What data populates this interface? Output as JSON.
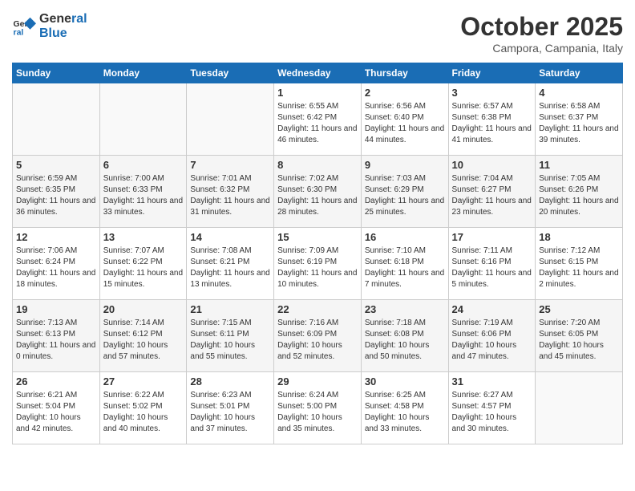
{
  "header": {
    "logo_line1": "General",
    "logo_line2": "Blue",
    "month": "October 2025",
    "location": "Campora, Campania, Italy"
  },
  "days_of_week": [
    "Sunday",
    "Monday",
    "Tuesday",
    "Wednesday",
    "Thursday",
    "Friday",
    "Saturday"
  ],
  "weeks": [
    [
      {
        "day": "",
        "info": ""
      },
      {
        "day": "",
        "info": ""
      },
      {
        "day": "",
        "info": ""
      },
      {
        "day": "1",
        "info": "Sunrise: 6:55 AM\nSunset: 6:42 PM\nDaylight: 11 hours and 46 minutes."
      },
      {
        "day": "2",
        "info": "Sunrise: 6:56 AM\nSunset: 6:40 PM\nDaylight: 11 hours and 44 minutes."
      },
      {
        "day": "3",
        "info": "Sunrise: 6:57 AM\nSunset: 6:38 PM\nDaylight: 11 hours and 41 minutes."
      },
      {
        "day": "4",
        "info": "Sunrise: 6:58 AM\nSunset: 6:37 PM\nDaylight: 11 hours and 39 minutes."
      }
    ],
    [
      {
        "day": "5",
        "info": "Sunrise: 6:59 AM\nSunset: 6:35 PM\nDaylight: 11 hours and 36 minutes."
      },
      {
        "day": "6",
        "info": "Sunrise: 7:00 AM\nSunset: 6:33 PM\nDaylight: 11 hours and 33 minutes."
      },
      {
        "day": "7",
        "info": "Sunrise: 7:01 AM\nSunset: 6:32 PM\nDaylight: 11 hours and 31 minutes."
      },
      {
        "day": "8",
        "info": "Sunrise: 7:02 AM\nSunset: 6:30 PM\nDaylight: 11 hours and 28 minutes."
      },
      {
        "day": "9",
        "info": "Sunrise: 7:03 AM\nSunset: 6:29 PM\nDaylight: 11 hours and 25 minutes."
      },
      {
        "day": "10",
        "info": "Sunrise: 7:04 AM\nSunset: 6:27 PM\nDaylight: 11 hours and 23 minutes."
      },
      {
        "day": "11",
        "info": "Sunrise: 7:05 AM\nSunset: 6:26 PM\nDaylight: 11 hours and 20 minutes."
      }
    ],
    [
      {
        "day": "12",
        "info": "Sunrise: 7:06 AM\nSunset: 6:24 PM\nDaylight: 11 hours and 18 minutes."
      },
      {
        "day": "13",
        "info": "Sunrise: 7:07 AM\nSunset: 6:22 PM\nDaylight: 11 hours and 15 minutes."
      },
      {
        "day": "14",
        "info": "Sunrise: 7:08 AM\nSunset: 6:21 PM\nDaylight: 11 hours and 13 minutes."
      },
      {
        "day": "15",
        "info": "Sunrise: 7:09 AM\nSunset: 6:19 PM\nDaylight: 11 hours and 10 minutes."
      },
      {
        "day": "16",
        "info": "Sunrise: 7:10 AM\nSunset: 6:18 PM\nDaylight: 11 hours and 7 minutes."
      },
      {
        "day": "17",
        "info": "Sunrise: 7:11 AM\nSunset: 6:16 PM\nDaylight: 11 hours and 5 minutes."
      },
      {
        "day": "18",
        "info": "Sunrise: 7:12 AM\nSunset: 6:15 PM\nDaylight: 11 hours and 2 minutes."
      }
    ],
    [
      {
        "day": "19",
        "info": "Sunrise: 7:13 AM\nSunset: 6:13 PM\nDaylight: 11 hours and 0 minutes."
      },
      {
        "day": "20",
        "info": "Sunrise: 7:14 AM\nSunset: 6:12 PM\nDaylight: 10 hours and 57 minutes."
      },
      {
        "day": "21",
        "info": "Sunrise: 7:15 AM\nSunset: 6:11 PM\nDaylight: 10 hours and 55 minutes."
      },
      {
        "day": "22",
        "info": "Sunrise: 7:16 AM\nSunset: 6:09 PM\nDaylight: 10 hours and 52 minutes."
      },
      {
        "day": "23",
        "info": "Sunrise: 7:18 AM\nSunset: 6:08 PM\nDaylight: 10 hours and 50 minutes."
      },
      {
        "day": "24",
        "info": "Sunrise: 7:19 AM\nSunset: 6:06 PM\nDaylight: 10 hours and 47 minutes."
      },
      {
        "day": "25",
        "info": "Sunrise: 7:20 AM\nSunset: 6:05 PM\nDaylight: 10 hours and 45 minutes."
      }
    ],
    [
      {
        "day": "26",
        "info": "Sunrise: 6:21 AM\nSunset: 5:04 PM\nDaylight: 10 hours and 42 minutes."
      },
      {
        "day": "27",
        "info": "Sunrise: 6:22 AM\nSunset: 5:02 PM\nDaylight: 10 hours and 40 minutes."
      },
      {
        "day": "28",
        "info": "Sunrise: 6:23 AM\nSunset: 5:01 PM\nDaylight: 10 hours and 37 minutes."
      },
      {
        "day": "29",
        "info": "Sunrise: 6:24 AM\nSunset: 5:00 PM\nDaylight: 10 hours and 35 minutes."
      },
      {
        "day": "30",
        "info": "Sunrise: 6:25 AM\nSunset: 4:58 PM\nDaylight: 10 hours and 33 minutes."
      },
      {
        "day": "31",
        "info": "Sunrise: 6:27 AM\nSunset: 4:57 PM\nDaylight: 10 hours and 30 minutes."
      },
      {
        "day": "",
        "info": ""
      }
    ]
  ]
}
